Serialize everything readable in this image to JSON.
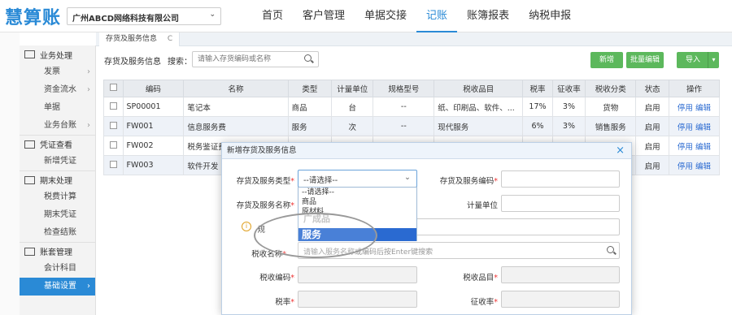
{
  "app": {
    "logo": "慧算账",
    "company": "广州ABCD网络科技有限公司"
  },
  "nav": [
    {
      "label": "首页",
      "active": false
    },
    {
      "label": "客户管理",
      "active": false
    },
    {
      "label": "单据交接",
      "active": false
    },
    {
      "label": "记账",
      "active": true
    },
    {
      "label": "账簿报表",
      "active": false
    },
    {
      "label": "纳税申报",
      "active": false
    }
  ],
  "sidebar": {
    "groups": [
      {
        "label": "业务处理",
        "items": [
          {
            "label": "发票",
            "arrow": "›"
          },
          {
            "label": "资金流水",
            "arrow": "›"
          },
          {
            "label": "单据",
            "arrow": ""
          },
          {
            "label": "业务台账",
            "arrow": "›"
          }
        ]
      },
      {
        "label": "凭证查看",
        "items": [
          {
            "label": "新增凭证",
            "arrow": ""
          }
        ]
      },
      {
        "label": "期末处理",
        "items": [
          {
            "label": "税费计算",
            "arrow": ""
          },
          {
            "label": "期末凭证",
            "arrow": ""
          },
          {
            "label": "检查结账",
            "arrow": ""
          }
        ]
      },
      {
        "label": "账套管理",
        "items": [
          {
            "label": "会计科目",
            "arrow": ""
          },
          {
            "label": "基础设置",
            "arrow": "›",
            "active": true
          }
        ]
      }
    ]
  },
  "tabs": {
    "active": "存货及服务信息",
    "refresh": "C"
  },
  "toolbar": {
    "title": "存货及服务信息",
    "search_label": "搜索：",
    "search_placeholder": "请输入存货编码或名称",
    "add_label": "新增",
    "batch_label": "批量编辑",
    "import_label": "导入",
    "import_caret": "▾"
  },
  "table": {
    "headers": [
      "编码",
      "名称",
      "类型",
      "计量单位",
      "规格型号",
      "税收品目",
      "税率",
      "征收率",
      "税收分类",
      "状态",
      "操作"
    ],
    "rows": [
      {
        "code": "SP00001",
        "name": "笔记本",
        "type": "商品",
        "unit": "台",
        "spec": "--",
        "item": "纸、印刷品、软件、...",
        "rate": "17%",
        "levy": "3%",
        "cls": "货物",
        "status": "启用",
        "op1": "停用",
        "op2": "编辑"
      },
      {
        "code": "FW001",
        "name": "信息服务费",
        "type": "服务",
        "unit": "次",
        "spec": "--",
        "item": "现代服务",
        "rate": "6%",
        "levy": "3%",
        "cls": "销售服务",
        "status": "启用",
        "op1": "停用",
        "op2": "编辑"
      },
      {
        "code": "FW002",
        "name": "税务鉴证费",
        "type": "",
        "unit": "",
        "spec": "",
        "item": "",
        "rate": "",
        "levy": "",
        "cls": "",
        "status": "启用",
        "op1": "停用",
        "op2": "编辑"
      },
      {
        "code": "FW003",
        "name": "软件开发",
        "type": "",
        "unit": "",
        "spec": "",
        "item": "",
        "rate": "",
        "levy": "",
        "cls": "",
        "status": "启用",
        "op1": "停用",
        "op2": "编辑"
      }
    ]
  },
  "modal": {
    "title": "新增存货及服务信息",
    "close": "×",
    "type_label": "存货及服务类型",
    "type_value": "--请选择--",
    "code_label": "存货及服务编码",
    "name_label": "存货及服务名称",
    "unit_label": "计量单位",
    "short_label": "规",
    "tax_name_label": "税收名称",
    "tax_name_placeholder": "请输入服务名称或编码后按Enter键搜索",
    "tax_code_label": "税收编码",
    "tax_item_label": "税收品目",
    "rate_label": "税率",
    "levy_label": "征收率",
    "required_mark": "*",
    "warn": "i",
    "options": [
      "--请选择--",
      "商品",
      "原材料",
      "广成品",
      "服务"
    ]
  }
}
